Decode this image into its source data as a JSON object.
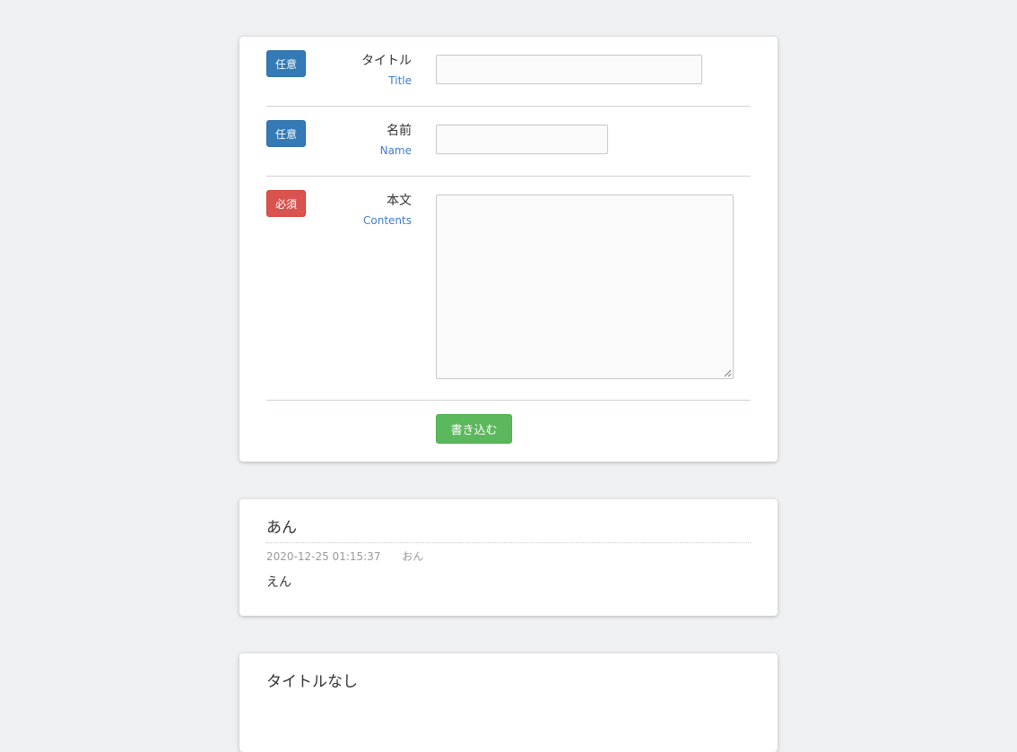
{
  "form": {
    "fields": [
      {
        "badge": "任意",
        "label_jp": "タイトル",
        "label_en": "Title",
        "value": ""
      },
      {
        "badge": "任意",
        "label_jp": "名前",
        "label_en": "Name",
        "value": ""
      },
      {
        "badge": "必須",
        "label_jp": "本文",
        "label_en": "Contents",
        "value": ""
      }
    ],
    "submit_label": "書き込む"
  },
  "posts": [
    {
      "title": "あん",
      "datetime": "2020-12-25 01:15:37",
      "author": "おん",
      "body": "えん"
    },
    {
      "title": "タイトルなし"
    }
  ],
  "colors": {
    "optional_badge": "#337ab7",
    "required_badge": "#d9534f",
    "submit_button": "#5cb85c",
    "english_label": "#3f7ccc"
  }
}
